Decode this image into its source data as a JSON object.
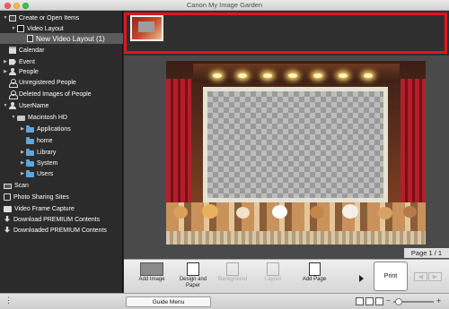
{
  "window": {
    "title": "Canon My Image Garden"
  },
  "sidebar": {
    "items": [
      {
        "label": "Create or Open Items",
        "icon": "box-icon",
        "expanded": true
      },
      {
        "label": "Video Layout",
        "icon": "video-icon",
        "expanded": true
      },
      {
        "label": "New Video Layout (1)",
        "icon": "document-icon",
        "selected": true
      },
      {
        "label": "Calendar",
        "icon": "calendar-icon"
      },
      {
        "label": "Event",
        "icon": "tag-icon",
        "expanded": false
      },
      {
        "label": "People",
        "icon": "person-icon",
        "expanded": false
      },
      {
        "label": "Unregistered People",
        "icon": "person-outline-icon"
      },
      {
        "label": "Deleted Images of People",
        "icon": "person-outline-icon"
      },
      {
        "label": "UserName",
        "icon": "person-icon",
        "expanded": true
      },
      {
        "label": "Macintosh HD",
        "icon": "drive-icon",
        "expanded": true
      },
      {
        "label": "Applications",
        "icon": "folder-icon",
        "expanded": false
      },
      {
        "label": "home",
        "icon": "folder-icon"
      },
      {
        "label": "Library",
        "icon": "folder-icon",
        "expanded": false
      },
      {
        "label": "System",
        "icon": "folder-icon",
        "expanded": false
      },
      {
        "label": "Users",
        "icon": "folder-icon",
        "expanded": false
      },
      {
        "label": "Scan",
        "icon": "scan-icon"
      },
      {
        "label": "Photo Sharing Sites",
        "icon": "share-icon"
      },
      {
        "label": "Video Frame Capture",
        "icon": "camera-icon"
      },
      {
        "label": "Download PREMIUM Contents",
        "icon": "download-icon"
      },
      {
        "label": "Downloaded PREMIUM Contents",
        "icon": "download-icon"
      }
    ]
  },
  "main": {
    "page_indicator": "Page 1 / 1"
  },
  "toolbar": {
    "add_image": "Add Image",
    "design_and_paper": "Design and Paper",
    "background": "Background",
    "layout": "Layout",
    "add_page": "Add Page",
    "print": "Print"
  },
  "statusbar": {
    "guide_menu": "Guide Menu"
  },
  "colors": {
    "selection_frame": "#e0161a",
    "sidebar_bg": "#2b2b2b",
    "main_bg": "#4a4a4a"
  }
}
